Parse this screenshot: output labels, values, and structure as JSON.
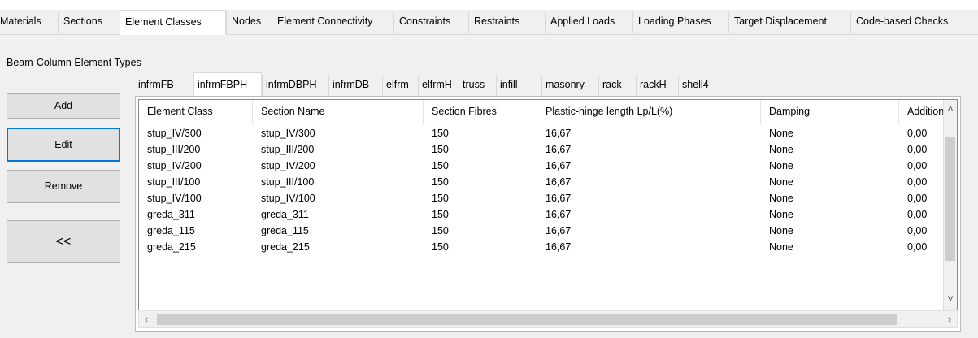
{
  "main_tabs": [
    "Materials",
    "Sections",
    "Element Classes",
    "Nodes",
    "Element Connectivity",
    "Constraints",
    "Restraints",
    "Applied Loads",
    "Loading Phases",
    "Target Displacement",
    "Code-based Checks"
  ],
  "active_main_tab": "Element Classes",
  "group_label": "Beam-Column Element Types",
  "buttons": {
    "add": "Add",
    "edit": "Edit",
    "remove": "Remove",
    "collapse": "<<"
  },
  "sub_tabs": [
    "infrmFB",
    "infrmFBPH",
    "infrmDBPH",
    "infrmDB",
    "elfrm",
    "elfrmH",
    "truss",
    "infill",
    "masonry",
    "rack",
    "rackH",
    "shell4"
  ],
  "active_sub_tab": "infrmFBPH",
  "table": {
    "columns": [
      "Element Class",
      "Section Name",
      "Section Fibres",
      "Plastic-hinge length Lp/L(%)",
      "Damping",
      "Additiona"
    ],
    "rows": [
      [
        "stup_IV/300",
        "stup_IV/300",
        "150",
        "16,67",
        "None",
        "0,00"
      ],
      [
        "stup_III/200",
        "stup_III/200",
        "150",
        "16,67",
        "None",
        "0,00"
      ],
      [
        "stup_IV/200",
        "stup_IV/200",
        "150",
        "16,67",
        "None",
        "0,00"
      ],
      [
        "stup_III/100",
        "stup_III/100",
        "150",
        "16,67",
        "None",
        "0,00"
      ],
      [
        "stup_IV/100",
        "stup_IV/100",
        "150",
        "16,67",
        "None",
        "0,00"
      ],
      [
        "greda_311",
        "greda_311",
        "150",
        "16,67",
        "None",
        "0,00"
      ],
      [
        "greda_115",
        "greda_115",
        "150",
        "16,67",
        "None",
        "0,00"
      ],
      [
        "greda_215",
        "greda_215",
        "150",
        "16,67",
        "None",
        "0,00"
      ]
    ]
  },
  "icons": {
    "scroll_up": "chevron-up-icon",
    "scroll_down": "chevron-down-icon",
    "scroll_left": "chevron-left-icon",
    "scroll_right": "chevron-right-icon"
  },
  "colors": {
    "focus_border": "#0078d7",
    "window_bg": "#f0f0f0"
  }
}
